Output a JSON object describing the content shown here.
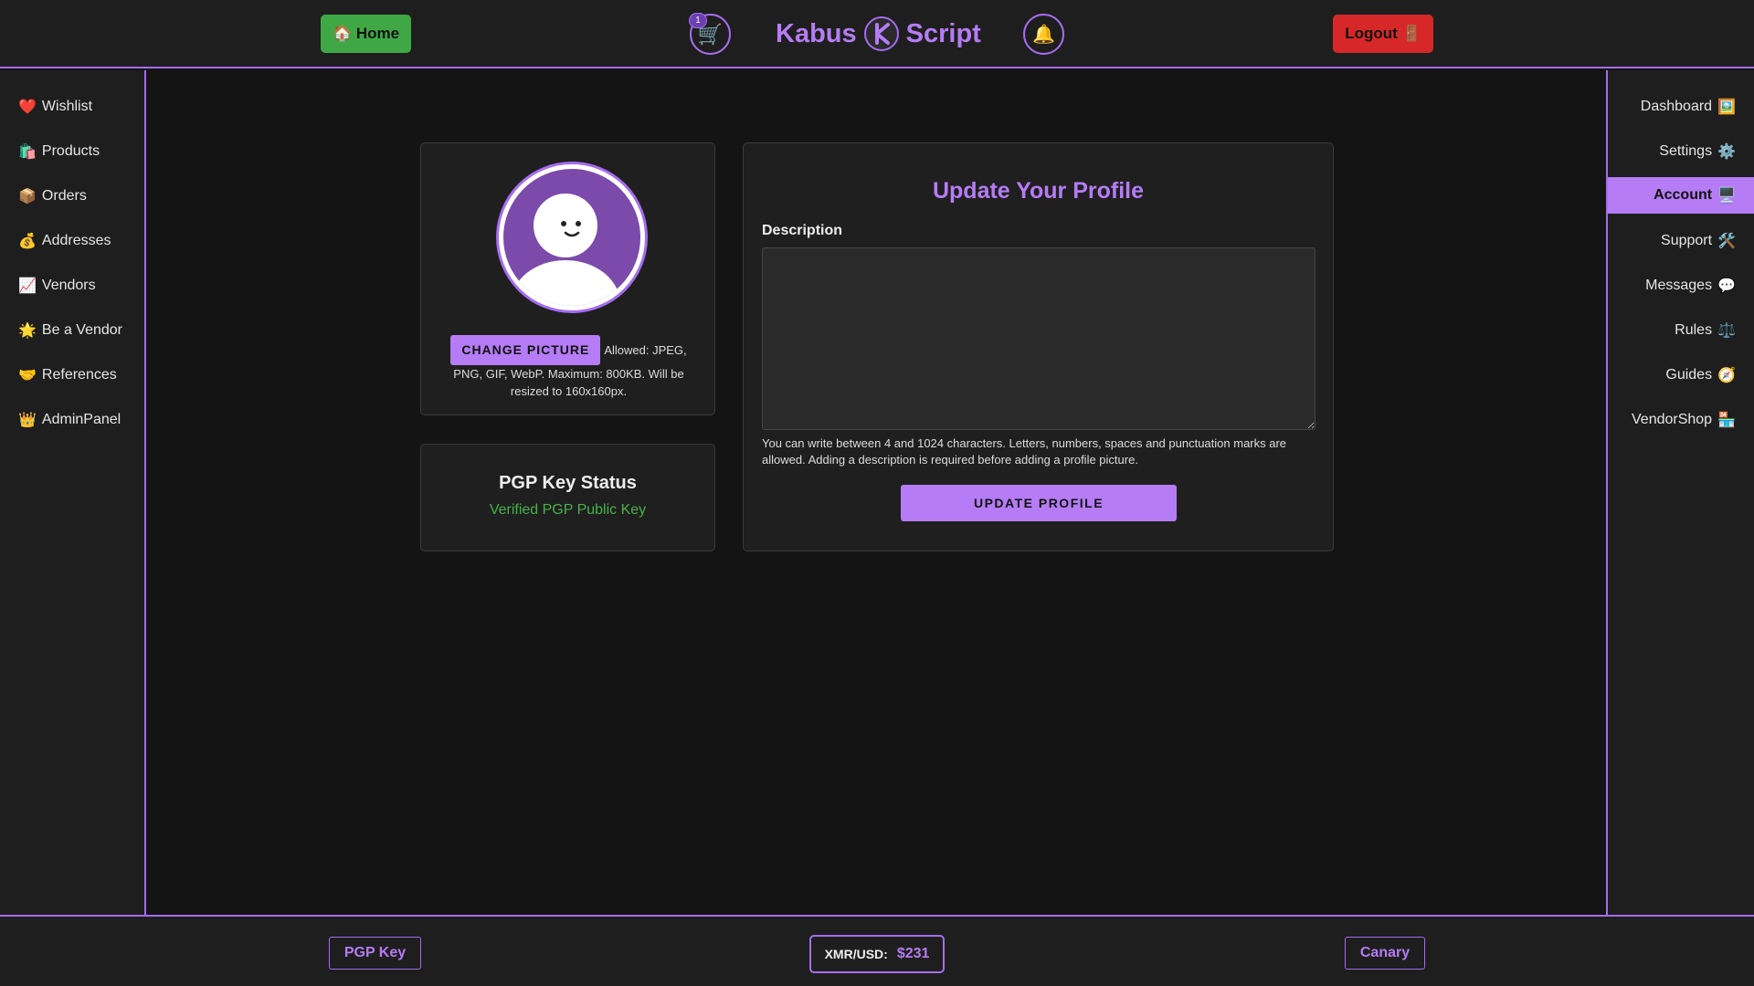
{
  "header": {
    "home_label": "🏠 Home",
    "cart_icon": "🛒",
    "cart_count": "1",
    "brand_left": "Kabus",
    "brand_right": "Script",
    "bell_icon": "🔔",
    "logout_label": "Logout 🚪"
  },
  "left_sidebar": {
    "items": [
      {
        "icon": "❤️",
        "label": "Wishlist"
      },
      {
        "icon": "🛍️",
        "label": "Products"
      },
      {
        "icon": "📦",
        "label": "Orders"
      },
      {
        "icon": "💰",
        "label": "Addresses"
      },
      {
        "icon": "📈",
        "label": "Vendors"
      },
      {
        "icon": "🌟",
        "label": "Be a Vendor"
      },
      {
        "icon": "🤝",
        "label": "References"
      },
      {
        "icon": "👑",
        "label": "AdminPanel"
      }
    ]
  },
  "right_sidebar": {
    "active_index": 2,
    "items": [
      {
        "label": "Dashboard",
        "icon": "🖼️"
      },
      {
        "label": "Settings",
        "icon": "⚙️"
      },
      {
        "label": "Account",
        "icon": "🖥️"
      },
      {
        "label": "Support",
        "icon": "🛠️"
      },
      {
        "label": "Messages",
        "icon": "💬"
      },
      {
        "label": "Rules",
        "icon": "⚖️"
      },
      {
        "label": "Guides",
        "icon": "🧭"
      },
      {
        "label": "VendorShop",
        "icon": "🏪"
      }
    ]
  },
  "avatar_card": {
    "change_button": "CHANGE PICTURE",
    "allowed_text": "Allowed: JPEG, PNG, GIF, WebP. Maximum: 800KB. Will be resized to 160x160px."
  },
  "pgp_card": {
    "title": "PGP Key Status",
    "status": "Verified PGP Public Key"
  },
  "profile_card": {
    "title": "Update Your Profile",
    "description_label": "Description",
    "description_value": "",
    "hint": "You can write between 4 and 1024 characters. Letters, numbers, spaces and punctuation marks are allowed. Adding a description is required before adding a profile picture.",
    "submit_label": "UPDATE PROFILE"
  },
  "footer": {
    "pgp_link": "PGP Key",
    "rate_label": "XMR/USD:",
    "rate_value": "$231",
    "canary_link": "Canary"
  },
  "colors": {
    "accent": "#b57cf5",
    "home_green": "#3fa845",
    "logout_red": "#d62828",
    "verified_green": "#48b04a",
    "background": "#141414",
    "panel": "#1e1e1e"
  }
}
